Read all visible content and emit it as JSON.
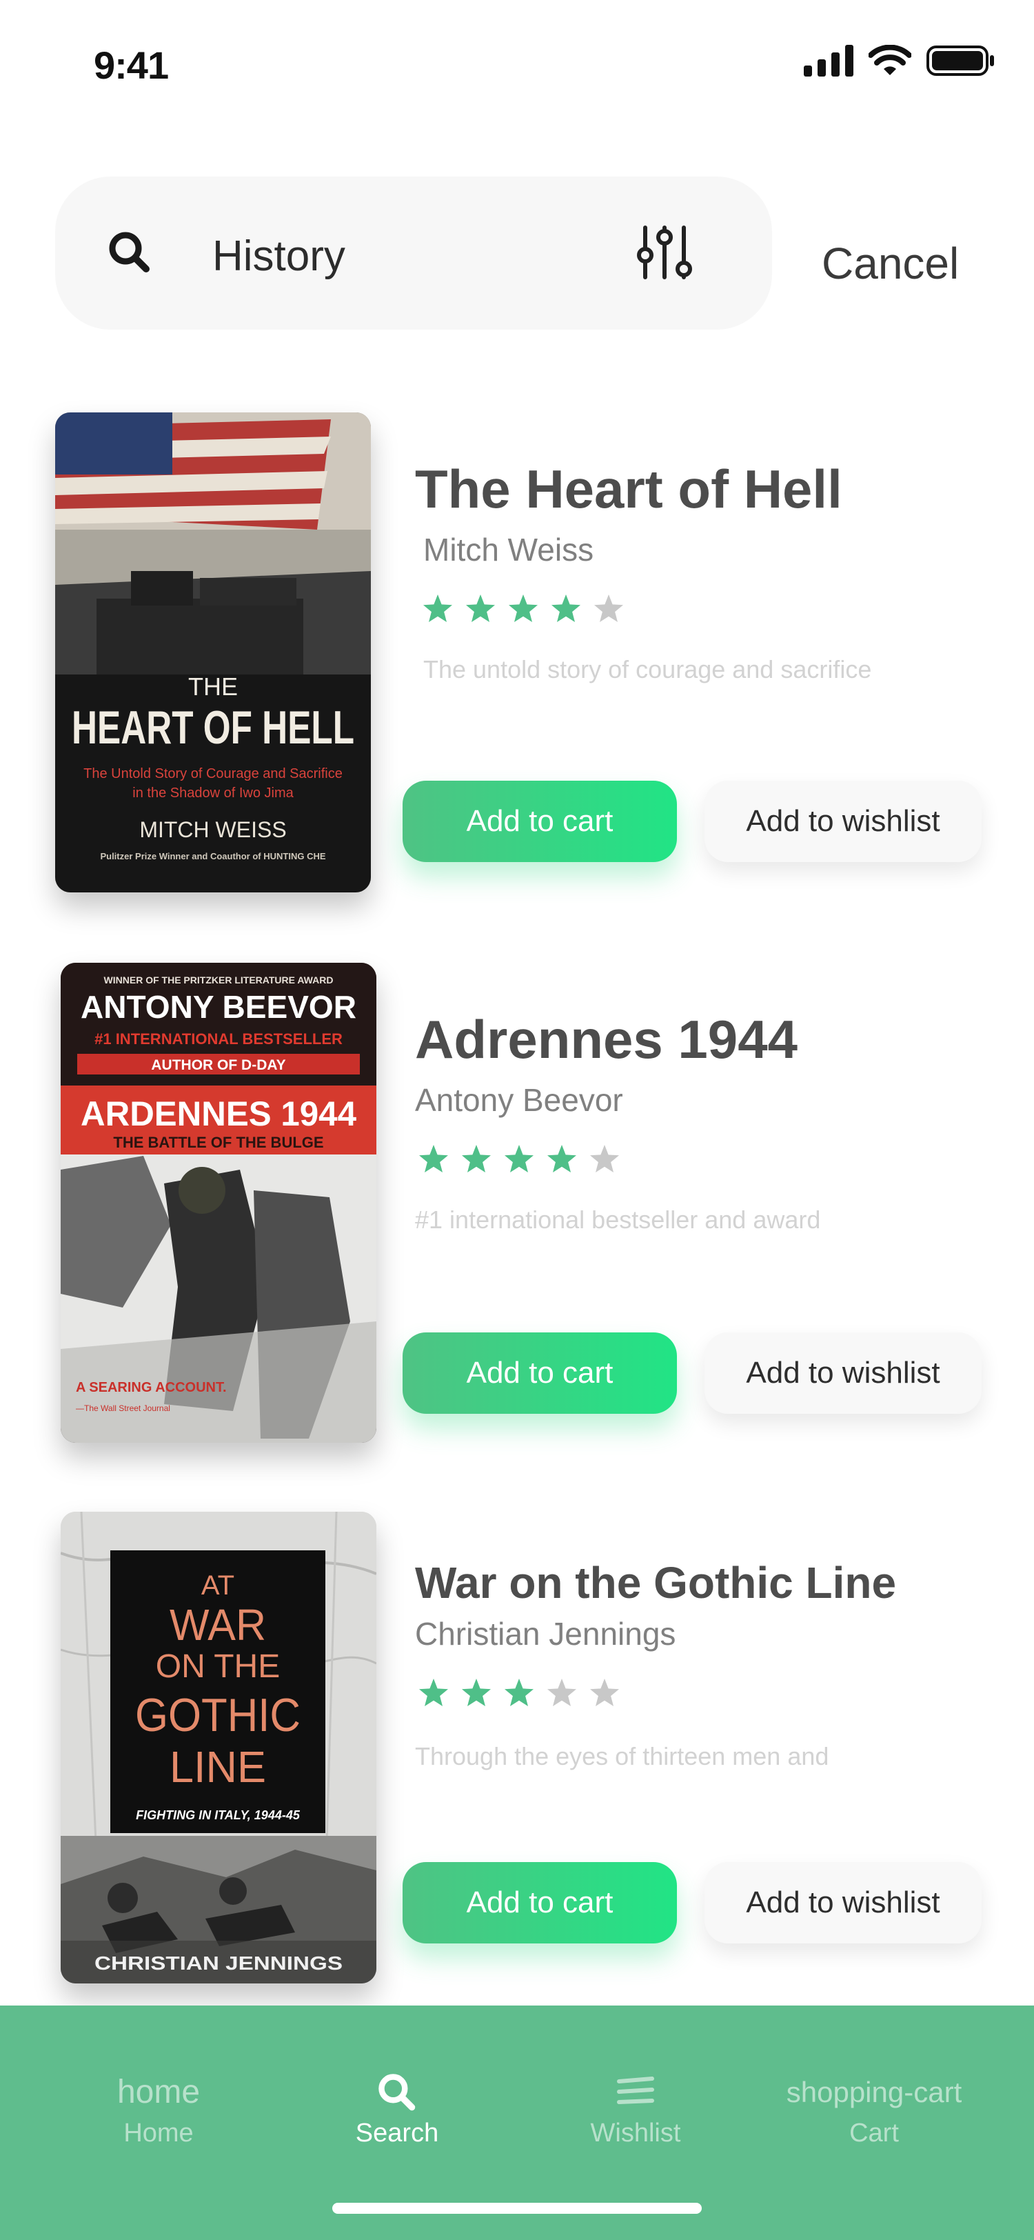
{
  "status_bar": {
    "time": "9:41"
  },
  "search": {
    "query": "History",
    "cancel_label": "Cancel"
  },
  "books": [
    {
      "title": "The Heart of Hell",
      "author": "Mitch Weiss",
      "rating": 4,
      "rating_max": 5,
      "description": "The untold story of courage and sacrifice",
      "cart_label": "Add to cart",
      "wishlist_label": "Add to wishlist",
      "cover": {
        "small_title": "THE",
        "big_title": "HEART OF HELL",
        "subtitle_line1": "The Untold Story of Courage and Sacrifice",
        "subtitle_line2": "in the Shadow of Iwo Jima",
        "author": "MITCH WEISS",
        "tagline": "Pulitzer Prize Winner and Coauthor of HUNTING CHE"
      }
    },
    {
      "title": "Adrennes 1944",
      "author": "Antony Beevor",
      "rating": 4,
      "rating_max": 5,
      "description": "#1 international bestseller and award",
      "cart_label": "Add to cart",
      "wishlist_label": "Add to wishlist",
      "cover": {
        "award": "WINNER OF THE PRITZKER LITERATURE AWARD",
        "author": "ANTONY BEEVOR",
        "bestseller": "#1 INTERNATIONAL BESTSELLER",
        "author_of": "AUTHOR OF D-DAY",
        "title": "ARDENNES 1944",
        "subtitle": "THE BATTLE OF THE BULGE",
        "quote": "A SEARING ACCOUNT.",
        "quote_source": "—The Wall Street Journal"
      }
    },
    {
      "title": "War on the Gothic Line",
      "author": "Christian Jennings",
      "rating": 3,
      "rating_max": 5,
      "description": "Through the eyes of thirteen men and",
      "cart_label": "Add to cart",
      "wishlist_label": "Add to wishlist",
      "cover": {
        "line1": "AT",
        "line2": "WAR",
        "line3": "ON THE",
        "line4": "GOTHIC",
        "line5": "LINE",
        "subtitle": "FIGHTING IN ITALY, 1944-45",
        "author": "CHRISTIAN JENNINGS"
      }
    }
  ],
  "colors": {
    "accent": "#35d685",
    "tabbar": "#5fbd8d",
    "star_on": "#4fbf88",
    "star_off": "#c8c8c8"
  },
  "tabbar": {
    "tabs": [
      {
        "icon_text": "home",
        "label": "Home"
      },
      {
        "icon": "search-icon",
        "label": "Search",
        "active": true
      },
      {
        "icon": "list-icon",
        "label": "Wishlist"
      },
      {
        "icon_text": "shopping-cart",
        "label": "Cart"
      }
    ]
  }
}
